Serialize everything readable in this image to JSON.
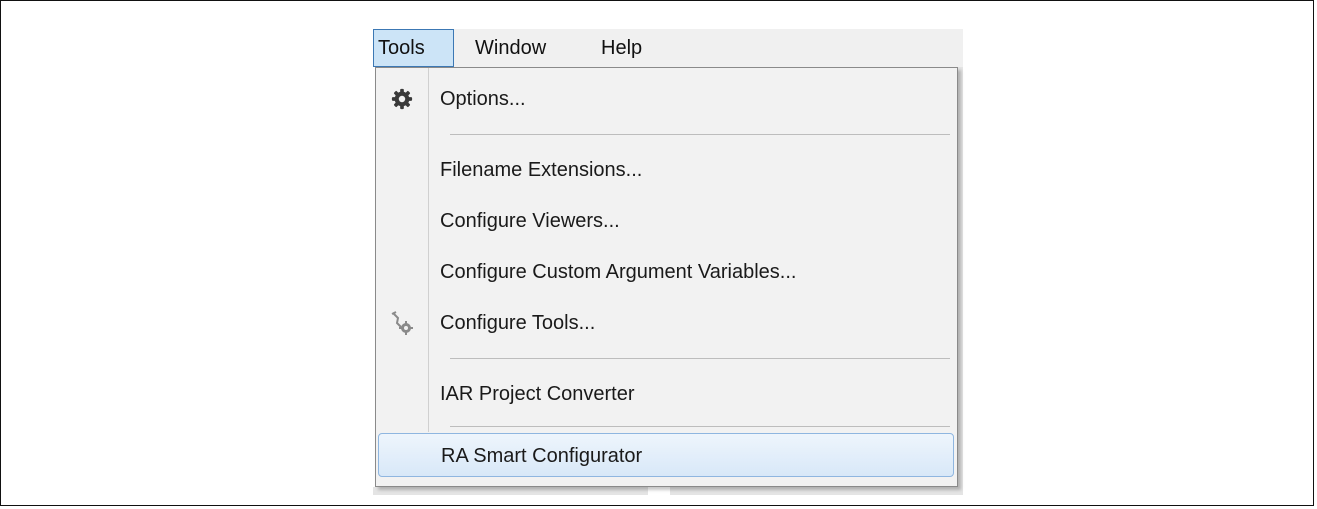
{
  "menubar": {
    "items": [
      {
        "label": "Tools",
        "open": true
      },
      {
        "label": "Window"
      },
      {
        "label": "Help"
      }
    ]
  },
  "tools_menu": {
    "items": [
      {
        "label": "Options...",
        "icon": "gear-icon"
      },
      {
        "label": "Filename Extensions..."
      },
      {
        "label": "Configure Viewers..."
      },
      {
        "label": "Configure Custom Argument Variables..."
      },
      {
        "label": "Configure Tools...",
        "icon": "tools-gear-icon"
      },
      {
        "label": "IAR Project Converter"
      },
      {
        "label": "RA Smart Configurator",
        "highlighted": true
      }
    ]
  },
  "colors": {
    "menu_bg": "#f2f2f2",
    "highlight_border": "#8fb6e0",
    "open_menu_border": "#3c78b4"
  }
}
